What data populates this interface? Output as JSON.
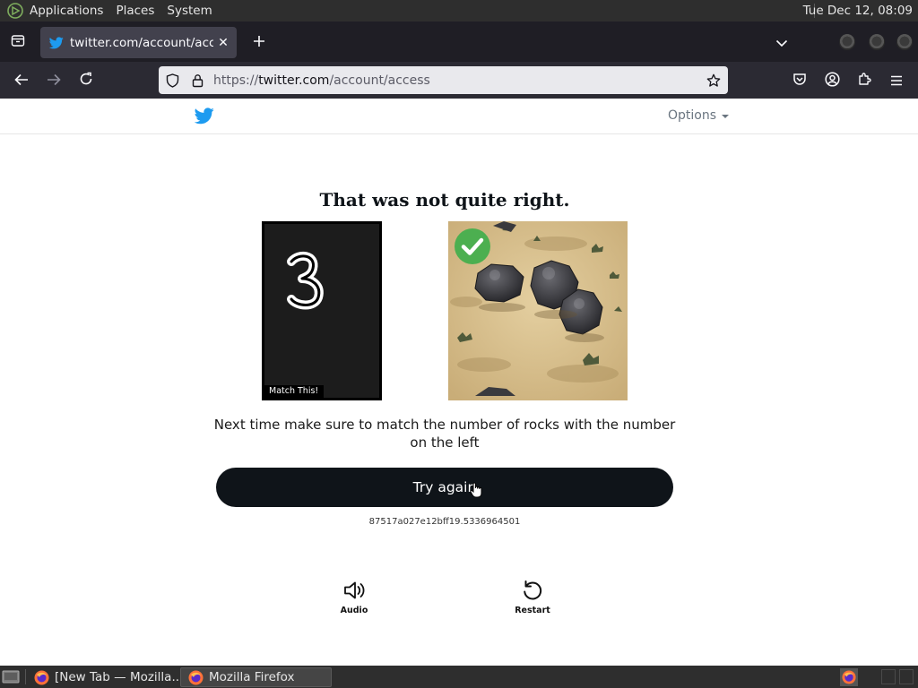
{
  "top_panel": {
    "menus": [
      "Applications",
      "Places",
      "System"
    ],
    "clock": "Tue Dec 12, 08:09"
  },
  "browser": {
    "tab": {
      "title": "twitter.com/account/access",
      "icon": "twitter-bird-icon"
    },
    "url": {
      "scheme": "https://",
      "host": "twitter.com",
      "path": "/account/access"
    },
    "icons": [
      "tab-list-icon",
      "close-icon",
      "plus-icon",
      "chevron-down-icon",
      "back-arrow-icon",
      "forward-arrow-icon",
      "reload-icon",
      "shield-icon",
      "lock-icon",
      "star-icon",
      "pocket-icon",
      "account-icon",
      "extensions-icon",
      "hamburger-menu-icon"
    ]
  },
  "page": {
    "options_label": "Options",
    "heading": "That was not quite right.",
    "match_label": "Match This!",
    "match_digit": "3",
    "instruction": "Next time make sure to match the number of rocks with the number on the left",
    "try_again_label": "Try again",
    "session_id": "87517a027e12bff19.5336964501",
    "audio_label": "Audio",
    "restart_label": "Restart"
  },
  "taskbar": {
    "items": [
      {
        "label": "[New Tab — Mozilla...",
        "active": false
      },
      {
        "label": "Mozilla Firefox",
        "active": true
      }
    ]
  },
  "colors": {
    "twitter_blue": "#1d9bf0",
    "button_bg": "#0f1419",
    "check_green": "#4caf50",
    "sand": "#d9c08e"
  }
}
